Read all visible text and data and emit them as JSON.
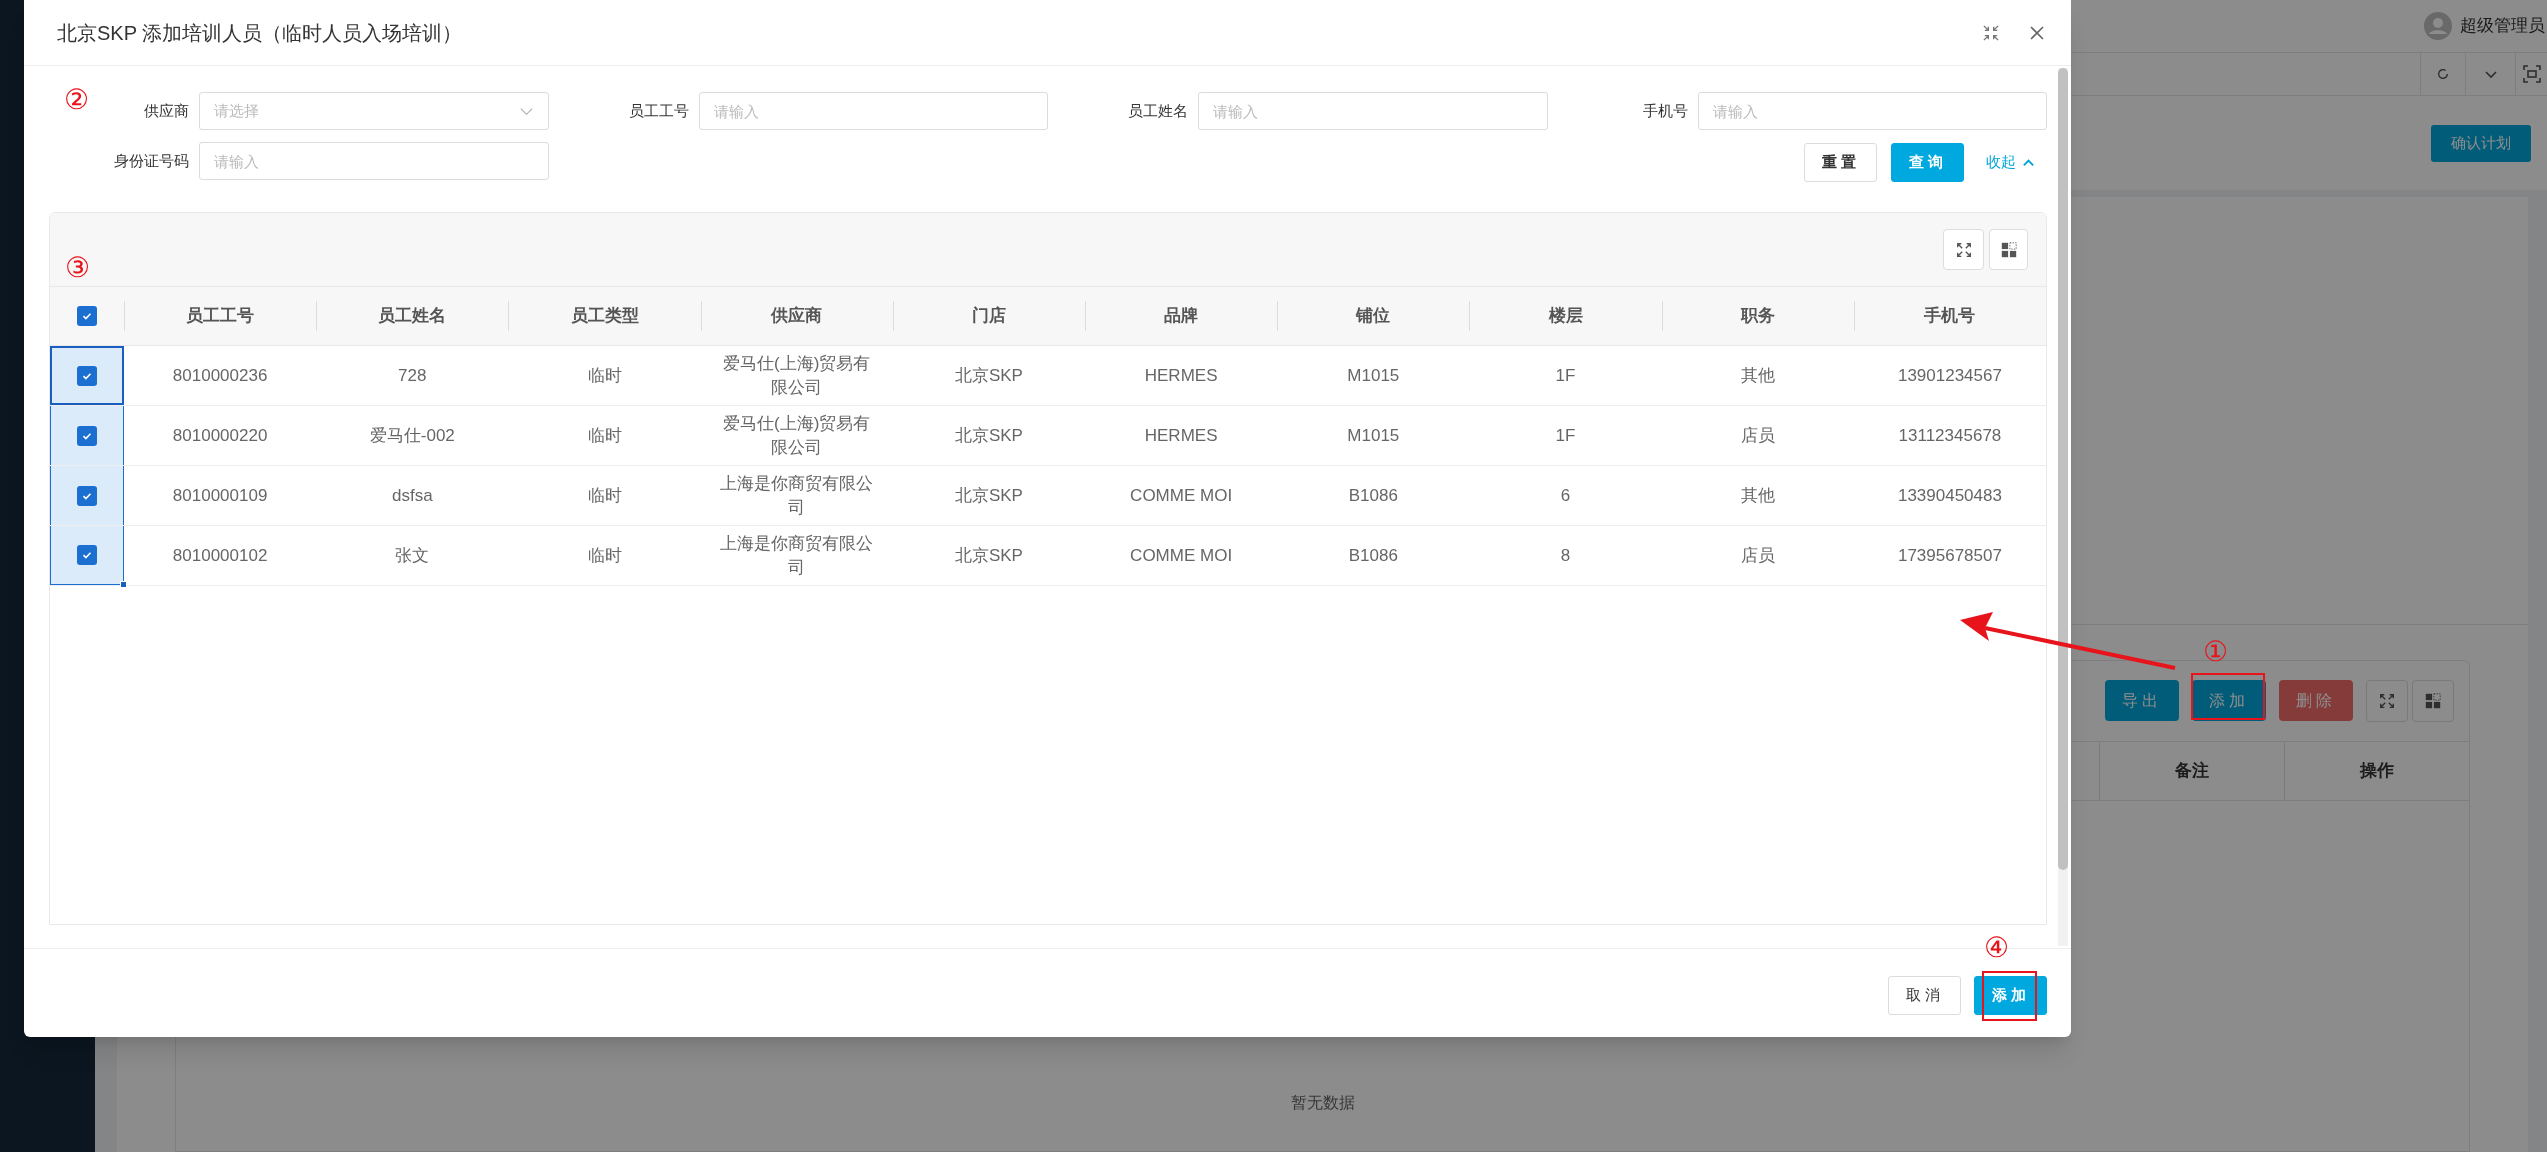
{
  "background": {
    "user_name": "超级管理员",
    "confirm_button": "确认计划",
    "toolbar_buttons": [
      {
        "label": "导出",
        "kind": "primary",
        "highlighted": false
      },
      {
        "label": "添加",
        "kind": "primary",
        "highlighted": true,
        "marker": "①"
      },
      {
        "label": "删除",
        "kind": "danger",
        "highlighted": false
      }
    ],
    "columns": [
      "备注",
      "操作"
    ],
    "empty_text": "暂无数据",
    "pointer_arrow": true
  },
  "dialog": {
    "title": "北京SKP 添加培训人员（临时人员入场培训）",
    "filter_marker": "②",
    "filters": [
      {
        "label": "供应商",
        "kind": "select",
        "placeholder": "请选择"
      },
      {
        "label": "员工工号",
        "kind": "input",
        "placeholder": "请输入"
      },
      {
        "label": "员工姓名",
        "kind": "input",
        "placeholder": "请输入"
      },
      {
        "label": "手机号",
        "kind": "input",
        "placeholder": "请输入"
      },
      {
        "label": "身份证号码",
        "kind": "input",
        "placeholder": "请输入"
      }
    ],
    "filter_buttons": [
      {
        "label": "重置",
        "kind": "default"
      },
      {
        "label": "查询",
        "kind": "primary"
      }
    ],
    "collapse_link": "收起",
    "table": {
      "marker": "③",
      "select_all": true,
      "columns": [
        "员工工号",
        "员工姓名",
        "员工类型",
        "供应商",
        "门店",
        "品牌",
        "铺位",
        "楼层",
        "职务",
        "手机号"
      ],
      "rows": [
        {
          "checked": true,
          "focused": true,
          "cells": [
            "8010000236",
            "728",
            "临时",
            "爱马仕(上海)贸易有限公司",
            "北京SKP",
            "HERMES",
            "M1015",
            "1F",
            "其他",
            "13901234567"
          ]
        },
        {
          "checked": true,
          "focused": false,
          "cells": [
            "8010000220",
            "爱马仕-002",
            "临时",
            "爱马仕(上海)贸易有限公司",
            "北京SKP",
            "HERMES",
            "M1015",
            "1F",
            "店员",
            "13112345678"
          ]
        },
        {
          "checked": true,
          "focused": false,
          "cells": [
            "8010000109",
            "dsfsa",
            "临时",
            "上海是你商贸有限公司",
            "北京SKP",
            "COMME MOI",
            "B1086",
            "6",
            "其他",
            "13390450483"
          ]
        },
        {
          "checked": true,
          "focused": false,
          "cells": [
            "8010000102",
            "张文",
            "临时",
            "上海是你商贸有限公司",
            "北京SKP",
            "COMME MOI",
            "B1086",
            "8",
            "店员",
            "17395678507"
          ]
        }
      ]
    },
    "footer_buttons": [
      {
        "label": "取消",
        "kind": "default",
        "highlighted": false
      },
      {
        "label": "添加",
        "kind": "primary",
        "highlighted": true,
        "marker": "④"
      }
    ]
  }
}
